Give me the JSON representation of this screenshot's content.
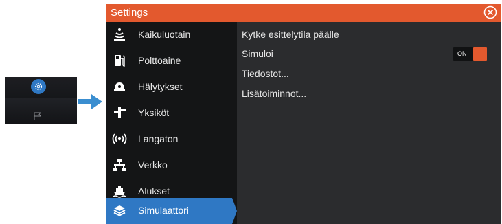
{
  "window": {
    "title": "Settings"
  },
  "sidebar": {
    "items": [
      {
        "label": "Kaikuluotain",
        "icon": "sonar-icon"
      },
      {
        "label": "Polttoaine",
        "icon": "fuel-pump-icon"
      },
      {
        "label": "Hälytykset",
        "icon": "alarm-icon"
      },
      {
        "label": "Yksiköt",
        "icon": "units-icon"
      },
      {
        "label": "Langaton",
        "icon": "wireless-icon"
      },
      {
        "label": "Verkko",
        "icon": "network-icon"
      },
      {
        "label": "Alukset",
        "icon": "vessels-icon"
      },
      {
        "label": "Simulaattori",
        "icon": "simulator-layers-icon"
      }
    ],
    "active_index": 7
  },
  "content": {
    "rows": [
      {
        "label": "Kytke esittelytila päälle"
      },
      {
        "label": "Simuloi",
        "toggle_label": "ON",
        "toggle_on": true
      },
      {
        "label": "Tiedostot..."
      },
      {
        "label": "Lisätoiminnot..."
      }
    ]
  },
  "colors": {
    "accent": "#e3592e",
    "selection": "#2f78c4"
  }
}
